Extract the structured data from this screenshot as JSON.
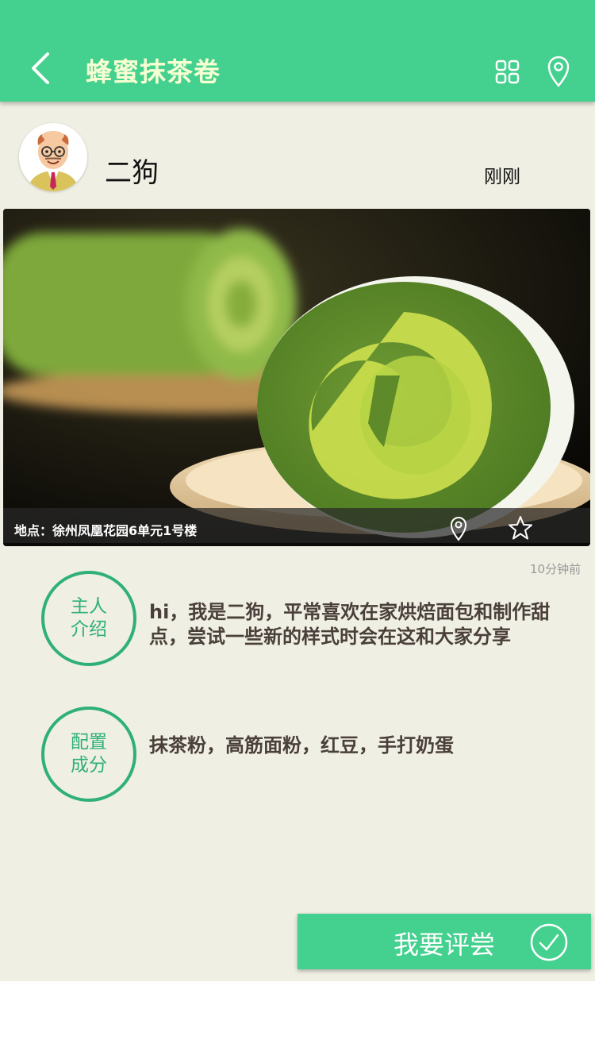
{
  "header": {
    "title": "蜂蜜抹茶卷",
    "back_icon": "chevron-left-icon",
    "grid_icon": "grid-icon",
    "location_icon": "map-pin-icon",
    "bar_color": "#44d08e",
    "title_color": "#f6ffd2"
  },
  "post": {
    "username": "二狗",
    "posted_time": "刚刚",
    "avatar_icon": "avatar"
  },
  "photo": {
    "location_text": "地点：徐州凤凰花园6单元1号楼",
    "pin_icon": "map-pin-icon",
    "favorite_icon": "star-icon"
  },
  "time_ago": "10分钟前",
  "sections": {
    "intro": {
      "badge_line1": "主人",
      "badge_line2": "介绍",
      "text": "hi，我是二狗，平常喜欢在家烘焙面包和制作甜点，尝试一些新的样式时会在这和大家分享"
    },
    "ingredients": {
      "badge_line1": "配置",
      "badge_line2": "成分",
      "text": "抹茶粉，高筋面粉，红豆，手打奶蛋"
    }
  },
  "review_button": {
    "label": "我要评尝",
    "icon": "check-circle-icon"
  },
  "colors": {
    "accent": "#44d08e",
    "badge_green": "#2fb07a",
    "page_bg": "#efefe3"
  }
}
